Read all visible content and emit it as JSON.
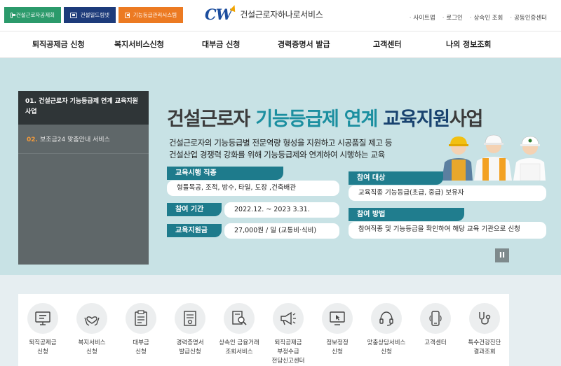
{
  "topbar": {
    "site_buttons": [
      "건설근로자공제회",
      "건설일드림넷",
      "기능등급관리시스템"
    ],
    "logo_mark": "CW",
    "logo_text": "건설근로자하나로서비스",
    "utils": [
      "사이트맵",
      "로그인",
      "상속인 조회",
      "공동인증센터"
    ]
  },
  "nav": {
    "items": [
      "퇴직공제금 신청",
      "복지서비스신청",
      "대부금 신청",
      "경력증명서 발급",
      "고객센터",
      "나의 정보조회"
    ]
  },
  "side": {
    "active": "01. 건설근로자 기능등급제 연계 교육지원사업",
    "item_num": "02.",
    "item_label": "보조금24 맞춤안내 서비스"
  },
  "hero": {
    "headline_a": "건설근로자 ",
    "headline_b": "기능등급제 연계 ",
    "headline_c": "교육지원",
    "headline_d": "사업",
    "sub1": "건설근로자의 기능등급별 전문역량 형성을 지원하고 시공품질 제고 등",
    "sub2": "건설산업 경쟁력 강화를 위해 기능등급제와 연계하여 시행하는 교육",
    "jobs_tag": "교육시행 직종",
    "jobs_value": "형틀목공, 조적, 방수, 타일, 도장 ,건축배관",
    "period_tag": "참여 기간",
    "period_value": "2022.12. ~ 2023 3.31.",
    "fee_tag": "교육지원금",
    "fee_value": "27,000원 / 일 (교통비·식비)",
    "target_tag": "참여 대상",
    "target_value": "교육직종 기능등급(초급, 중급) 보유자",
    "method_tag": "참여 방법",
    "method_value": "참여직종 및 기능등급을 확인하여 해당 교육 기관으로 신청",
    "pause_label": "II"
  },
  "quick": {
    "items": [
      {
        "label": "퇴직공제금\n신청",
        "icon": "monitor-icon"
      },
      {
        "label": "복지서비스\n신청",
        "icon": "hands-heart-icon"
      },
      {
        "label": "대부금\n신청",
        "icon": "clipboard-icon"
      },
      {
        "label": "경력증명서\n발급신청",
        "icon": "certificate-icon"
      },
      {
        "label": "상속인 금융거래\n조회서비스",
        "icon": "document-search-icon"
      },
      {
        "label": "퇴직공제금\n부정수급\n전담신고센터",
        "icon": "megaphone-icon"
      },
      {
        "label": "정보정정\n신청",
        "icon": "monitor-cursor-icon"
      },
      {
        "label": "맞춤상담서비스\n신청",
        "icon": "headset-icon"
      },
      {
        "label": "고객센터",
        "icon": "phone-icon"
      },
      {
        "label": "특수건강진단\n결과조회",
        "icon": "stethoscope-icon"
      }
    ]
  }
}
